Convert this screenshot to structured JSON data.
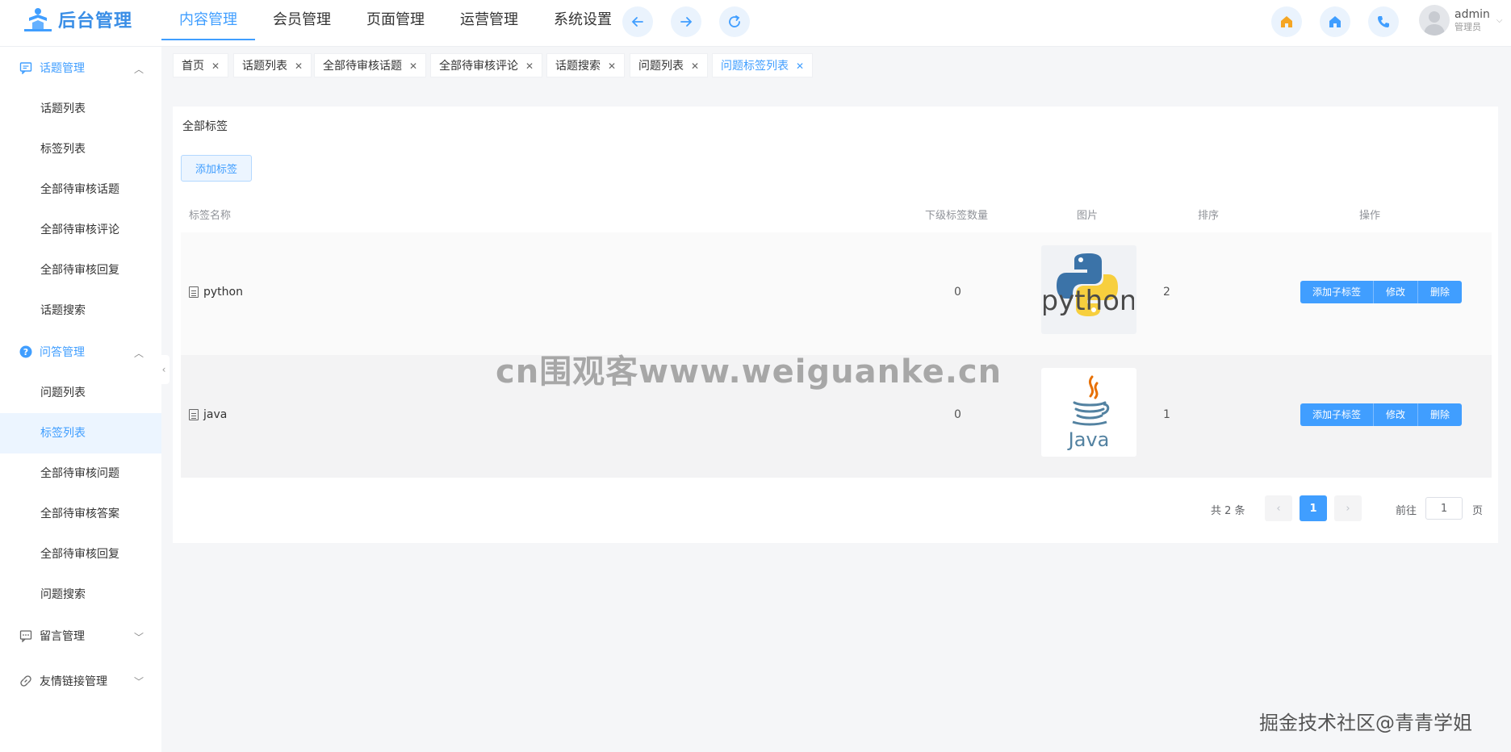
{
  "app": {
    "logo_text": "后台管理"
  },
  "topnav": [
    {
      "label": "内容管理",
      "active": true
    },
    {
      "label": "会员管理"
    },
    {
      "label": "页面管理"
    },
    {
      "label": "运营管理"
    },
    {
      "label": "系统设置"
    }
  ],
  "nav_buttons": {
    "back_icon": "arrow-left-icon",
    "forward_icon": "arrow-right-icon",
    "refresh_icon": "refresh-icon"
  },
  "header_actions": [
    "home-icon-orange",
    "home-icon-blue",
    "phone-icon"
  ],
  "user": {
    "name": "admin",
    "role": "管理员"
  },
  "sidebar": {
    "groups": [
      {
        "label": "话题管理",
        "icon": "chat-icon",
        "expanded": true,
        "items": [
          "话题列表",
          "标签列表",
          "全部待审核话题",
          "全部待审核评论",
          "全部待审核回复",
          "话题搜索"
        ]
      },
      {
        "label": "问答管理",
        "icon": "question-icon",
        "expanded": true,
        "items": [
          "问题列表",
          "标签列表",
          "全部待审核问题",
          "全部待审核答案",
          "全部待审核回复",
          "问题搜索"
        ]
      },
      {
        "label": "留言管理",
        "icon": "message-icon",
        "expanded": false
      },
      {
        "label": "友情链接管理",
        "icon": "link-icon",
        "expanded": false
      }
    ]
  },
  "tags": [
    {
      "label": "首页"
    },
    {
      "label": "话题列表"
    },
    {
      "label": "全部待审核话题"
    },
    {
      "label": "全部待审核评论"
    },
    {
      "label": "话题搜索"
    },
    {
      "label": "问题列表"
    },
    {
      "label": "问题标签列表",
      "active": true
    }
  ],
  "card": {
    "title": "全部标签",
    "add_button": "添加标签",
    "columns": [
      "标签名称",
      "下级标签数量",
      "图片",
      "排序",
      "操作"
    ],
    "rows": [
      {
        "name": "python",
        "children": "0",
        "image": "python-logo",
        "sort": "2"
      },
      {
        "name": "java",
        "children": "0",
        "image": "java-logo",
        "sort": "1"
      }
    ],
    "row_actions": [
      "添加子标签",
      "修改",
      "删除"
    ]
  },
  "pagination": {
    "total": "共 2 条",
    "current": "1",
    "goto_label": "前往",
    "goto_value": "1",
    "page_suffix": "页"
  },
  "watermarks": {
    "center": "cn围观客www.weiguanke.cn",
    "corner": "掘金技术社区@青青学姐"
  },
  "colors": {
    "primary": "#409eff",
    "accent_orange": "#f5a623"
  }
}
